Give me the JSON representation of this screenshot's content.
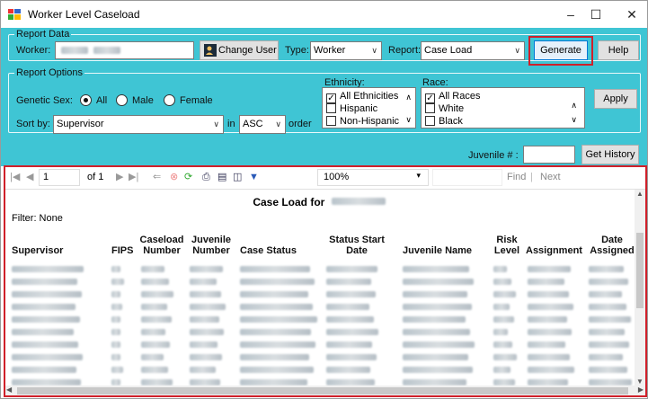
{
  "window": {
    "title": "Worker Level Caseload",
    "minimize": "–",
    "maximize": "☐",
    "close": "✕"
  },
  "report_data": {
    "group_label": "Report Data",
    "worker_label": "Worker:",
    "change_user_label": "Change User",
    "type_label": "Type:",
    "type_value": "Worker",
    "report_label": "Report:",
    "report_value": "Case Load",
    "generate_label": "Generate",
    "help_label": "Help"
  },
  "report_options": {
    "group_label": "Report Options",
    "genetic_sex_label": "Genetic Sex:",
    "sex_options": [
      "All",
      "Male",
      "Female"
    ],
    "sex_selected": "All",
    "sort_by_label": "Sort by:",
    "sort_by_value": "Supervisor",
    "in_label": "in",
    "order_value": "ASC",
    "order_label": "order",
    "ethnicity_label": "Ethnicity:",
    "ethnicity_items": [
      {
        "label": "All Ethnicities",
        "checked": true
      },
      {
        "label": "Hispanic",
        "checked": false
      },
      {
        "label": "Non-Hispanic",
        "checked": false
      }
    ],
    "race_label": "Race:",
    "race_items": [
      {
        "label": "All Races",
        "checked": true
      },
      {
        "label": "White",
        "checked": false
      },
      {
        "label": "Black",
        "checked": false
      }
    ],
    "apply_label": "Apply"
  },
  "juvenile": {
    "label": "Juvenile # :",
    "value": "",
    "get_history_label": "Get History"
  },
  "toolbar": {
    "page_value": "1",
    "of_label": "of 1",
    "zoom_value": "100%",
    "find_label": "Find",
    "separator": "|",
    "next_label": "Next"
  },
  "report": {
    "title": "Case Load for",
    "filter": "Filter: None",
    "columns": [
      "Supervisor",
      "FIPS",
      "Caseload Number",
      "Juvenile Number",
      "Case Status",
      "Status Start Date",
      "Juvenile Name",
      "Risk Level",
      "Assignment",
      "Date Assigned"
    ]
  },
  "colors": {
    "panel": "#3fc5d4",
    "highlight": "#d0202a"
  }
}
